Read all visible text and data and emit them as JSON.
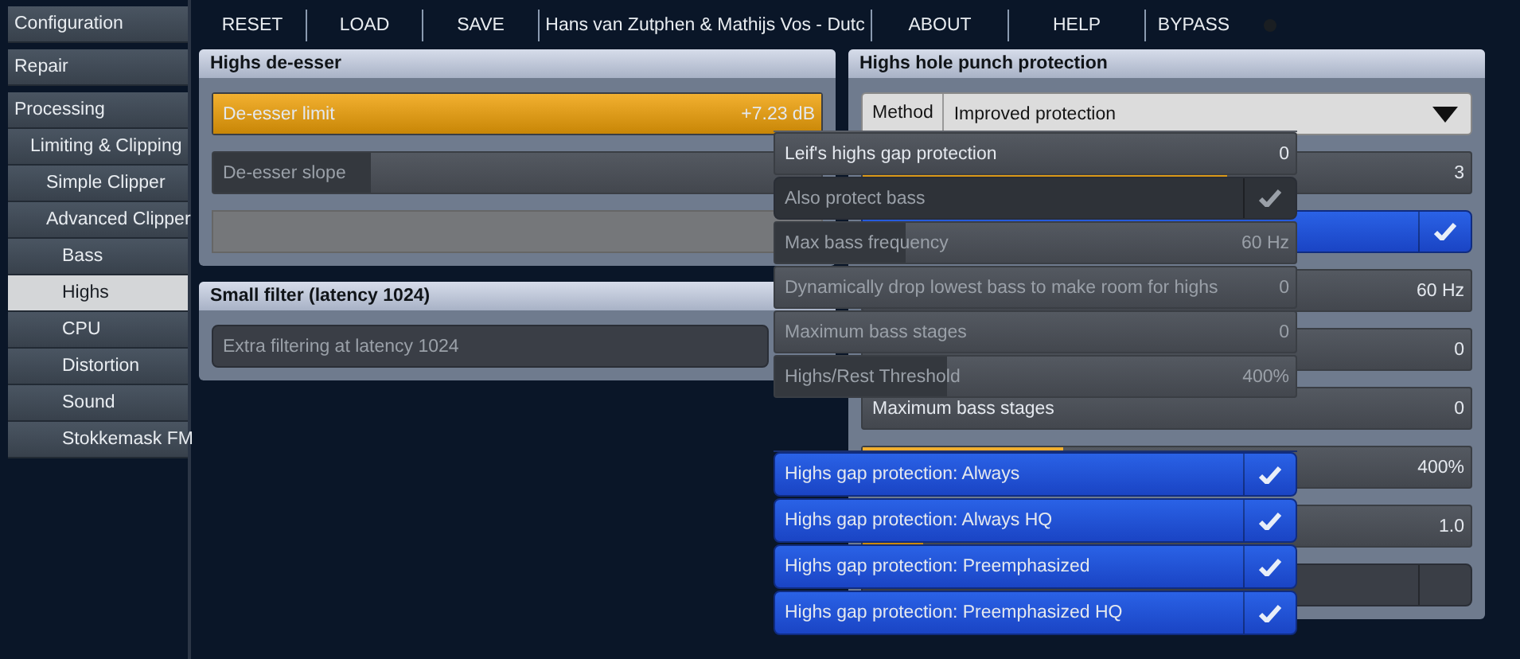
{
  "sidebar": {
    "items": [
      {
        "label": "Configuration",
        "selected": false
      },
      {
        "label": "Repair",
        "selected": false
      },
      {
        "label": "Processing",
        "selected": false,
        "children": [
          {
            "label": "Limiting & Clipping",
            "selected": false,
            "children": [
              {
                "label": "Simple Clipper",
                "selected": false
              },
              {
                "label": "Advanced Clipper",
                "selected": false,
                "children": [
                  {
                    "label": "Bass",
                    "selected": false
                  },
                  {
                    "label": "Highs",
                    "selected": true
                  },
                  {
                    "label": "CPU",
                    "selected": false
                  },
                  {
                    "label": "Distortion",
                    "selected": false
                  },
                  {
                    "label": "Sound",
                    "selected": false
                  },
                  {
                    "label": "Stokkemask FM",
                    "selected": false
                  }
                ]
              }
            ]
          }
        ]
      }
    ]
  },
  "menu": {
    "items": [
      {
        "label": "RESET"
      },
      {
        "label": "LOAD"
      },
      {
        "label": "SAVE"
      },
      {
        "label": "Hans van Zutphen & Mathijs Vos - Dutc"
      },
      {
        "label": "ABOUT"
      },
      {
        "label": "HELP"
      },
      {
        "label": "BYPASS"
      }
    ],
    "bypass_on": false
  },
  "left_panels": [
    {
      "title": "Highs de-esser",
      "controls": [
        {
          "kind": "slider",
          "label": "De-esser limit",
          "value": "+7.23 dB",
          "level": 1,
          "disabled": false
        },
        {
          "kind": "slider",
          "label": "De-esser slope",
          "level": 0.26,
          "disabled": true
        },
        {
          "kind": "blank"
        }
      ]
    },
    {
      "title": "Small filter (latency 1024)",
      "controls": [
        {
          "kind": "checkbox",
          "label": "Extra filtering at latency 1024",
          "disabled": true
        }
      ]
    }
  ],
  "right_panel": {
    "title": "Highs hole punch protection",
    "controls": [
      {
        "kind": "dropdown",
        "label": "Method",
        "value": "Improved protection"
      },
      {
        "kind": "slider",
        "value": "3",
        "level": 0.6,
        "disabled": false
      },
      {
        "kind": "checkbox",
        "checked": true,
        "disabled": false
      },
      {
        "kind": "slider",
        "value": "60 Hz",
        "level": 0,
        "disabled": false
      },
      {
        "kind": "slider",
        "value": "0",
        "level": 0,
        "disabled": false
      },
      {
        "kind": "slider",
        "label": "Maximum bass stages",
        "value": "0",
        "level": 0,
        "disabled": false
      },
      {
        "kind": "slider",
        "value": "400%",
        "level": 0.33,
        "disabled": false
      },
      {
        "kind": "slider",
        "value": "1.0",
        "level": 0.1,
        "disabled": false
      },
      {
        "kind": "checkbox",
        "checked": false
      }
    ]
  },
  "floating_list": {
    "controls": [
      {
        "kind": "slider",
        "label": "Leif's highs gap protection",
        "value": "0",
        "level": 0,
        "disabled": false
      },
      {
        "kind": "checkbox",
        "label": "Also protect bass",
        "checked": true,
        "disabled": true
      },
      {
        "kind": "slider",
        "label": "Max bass frequency",
        "value": "60 Hz",
        "level": 0.25,
        "disabled": true
      },
      {
        "kind": "slider",
        "label": "Dynamically drop lowest bass to make room for highs",
        "value": "0",
        "level": 0,
        "disabled": true
      },
      {
        "kind": "slider",
        "label": "Maximum bass stages",
        "value": "0",
        "level": 0,
        "disabled": true
      },
      {
        "kind": "slider",
        "label": "Highs/Rest Threshold",
        "value": "400%",
        "level": 0.33,
        "disabled": true
      }
    ]
  },
  "floating_checks": [
    {
      "label": "Highs gap protection: Always",
      "checked": true
    },
    {
      "label": "Highs gap protection: Always HQ",
      "checked": true
    },
    {
      "label": "Highs gap protection: Preemphasized",
      "checked": true
    },
    {
      "label": "Highs gap protection: Preemphasized HQ",
      "checked": true
    }
  ]
}
